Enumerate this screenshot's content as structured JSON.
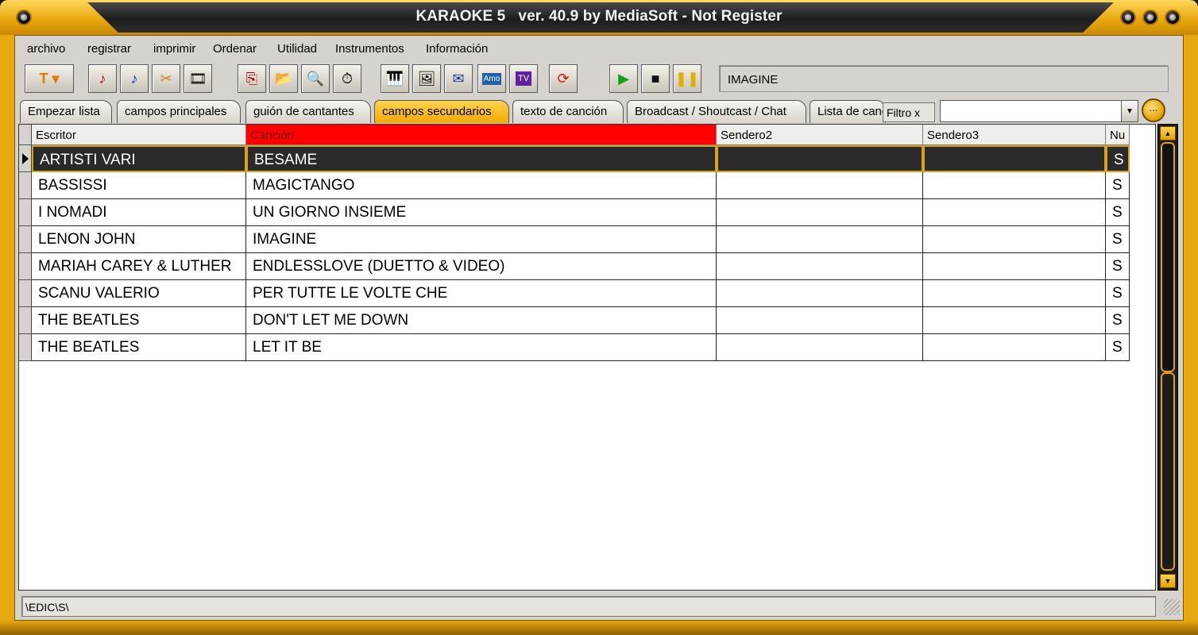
{
  "window": {
    "title": "KARAOKE 5   ver. 40.9 by MediaSoft - Not Register"
  },
  "menu": [
    "archivo",
    "registrar",
    "imprimir",
    "Ordenar",
    "Utilidad",
    "Instrumentos",
    "Información"
  ],
  "toolbar": {
    "now_playing": "IMAGINE",
    "icons": [
      "font-dropdown-icon",
      "red-note-icon",
      "blue-note-icon",
      "tools-icon",
      "film-icon",
      "copy-icon",
      "folder-icon",
      "search-doc-icon",
      "timer-icon",
      "keyboard-icon",
      "image-icon",
      "envelope-icon",
      "lyrics-icon",
      "tv-icon",
      "refresh-icon",
      "play-icon",
      "stop-icon",
      "pause-icon"
    ]
  },
  "tabs": [
    {
      "label": "Empezar lista",
      "active": false
    },
    {
      "label": "campos principales",
      "active": false
    },
    {
      "label": "guión de cantantes",
      "active": false
    },
    {
      "label": "campos secundarios",
      "active": true
    },
    {
      "label": "texto de canción",
      "active": false
    },
    {
      "label": "Broadcast / Shoutcast / Chat",
      "active": false
    },
    {
      "label": "Lista de canciones",
      "active": false
    }
  ],
  "filter": {
    "label": "Filtro x",
    "value": "",
    "button": "..."
  },
  "grid": {
    "columns": [
      "Escritor",
      "Canción",
      "Sendero2",
      "Sendero3",
      "Nu"
    ],
    "sorted_column": "Canción",
    "rows": [
      {
        "escritor": "ARTISTI VARI",
        "cancion": "BESAME",
        "sendero2": "",
        "sendero3": "",
        "nu": "S",
        "selected": true
      },
      {
        "escritor": "BASSISSI",
        "cancion": "MAGICTANGO",
        "sendero2": "",
        "sendero3": "",
        "nu": "S",
        "selected": false
      },
      {
        "escritor": "I NOMADI",
        "cancion": "UN GIORNO INSIEME",
        "sendero2": "",
        "sendero3": "",
        "nu": "S",
        "selected": false
      },
      {
        "escritor": "LENON JOHN",
        "cancion": "IMAGINE",
        "sendero2": "",
        "sendero3": "",
        "nu": "S",
        "selected": false
      },
      {
        "escritor": "MARIAH CAREY & LUTHER",
        "cancion": "ENDLESSLOVE (DUETTO & VIDEO)",
        "sendero2": "",
        "sendero3": "",
        "nu": "S",
        "selected": false
      },
      {
        "escritor": "SCANU VALERIO",
        "cancion": "PER TUTTE LE VOLTE CHE",
        "sendero2": "",
        "sendero3": "",
        "nu": "S",
        "selected": false
      },
      {
        "escritor": "THE BEATLES",
        "cancion": "DON'T LET ME DOWN",
        "sendero2": "",
        "sendero3": "",
        "nu": "S",
        "selected": false
      },
      {
        "escritor": "THE BEATLES",
        "cancion": "LET IT BE",
        "sendero2": "",
        "sendero3": "",
        "nu": "S",
        "selected": false
      }
    ]
  },
  "status": {
    "path": "\\EDIC\\S\\"
  },
  "colors": {
    "frame": "#e8a910",
    "active_tab": "#f2aa06",
    "sorted_header": "#ff0000",
    "selection_border": "#d9a21a"
  }
}
